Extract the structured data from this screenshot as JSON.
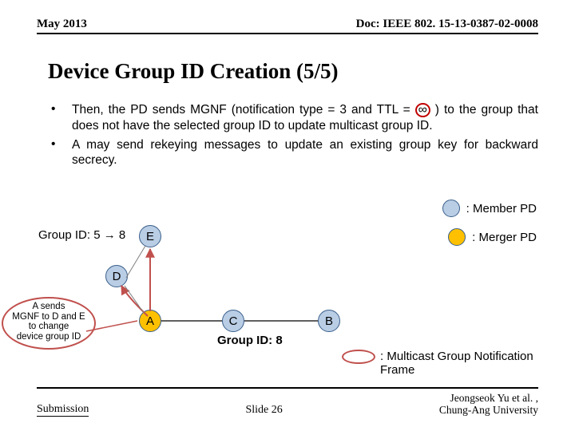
{
  "header": {
    "date": "May 2013",
    "doc": "Doc: IEEE 802. 15-13-0387-02-0008"
  },
  "title": "Device Group ID Creation (5/5)",
  "bullets": [
    {
      "pre": "Then, the PD sends MGNF (notification type = 3 and TTL =",
      "inf": "∞",
      "post": ") to the group that does not have the selected group ID to update multicast group ID."
    },
    {
      "text": "A may send rekeying messages to update an existing group key for backward secrecy."
    }
  ],
  "legend": {
    "member": ": Member PD",
    "merger": ": Merger PD",
    "mgnf": ": Multicast Group Notification Frame"
  },
  "group_label_left": {
    "pre": "Group ID: 5 ",
    "arrow": "→",
    "post": " 8"
  },
  "group_label_right": "Group ID: 8",
  "nodes": {
    "A": "A",
    "B": "B",
    "C": "C",
    "D": "D",
    "E": "E"
  },
  "callout": {
    "l1": "A  sends",
    "l2": "MGNF  to D and E",
    "l3": "to change",
    "l4": "device group ID"
  },
  "footer": {
    "left": "Submission",
    "center": "Slide 26",
    "right1": "Jeongseok Yu et al. ,",
    "right2": "Chung-Ang University"
  }
}
